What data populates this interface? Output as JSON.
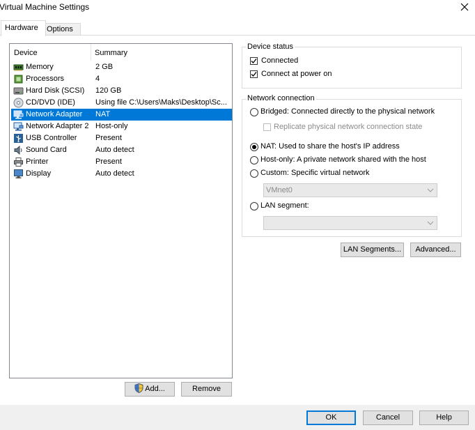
{
  "window": {
    "title": "Virtual Machine Settings"
  },
  "tabs": [
    {
      "label": "Hardware",
      "active": true
    },
    {
      "label": "Options",
      "active": false
    }
  ],
  "device_list": {
    "columns": [
      "Device",
      "Summary"
    ],
    "rows": [
      {
        "device": "Memory",
        "summary": "2 GB",
        "icon": "memory-icon",
        "selected": false
      },
      {
        "device": "Processors",
        "summary": "4",
        "icon": "processor-icon",
        "selected": false
      },
      {
        "device": "Hard Disk (SCSI)",
        "summary": "120 GB",
        "icon": "hard-disk-icon",
        "selected": false
      },
      {
        "device": "CD/DVD (IDE)",
        "summary": "Using file C:\\Users\\Maks\\Desktop\\Sc...",
        "icon": "cd-dvd-icon",
        "selected": false
      },
      {
        "device": "Network Adapter",
        "summary": "NAT",
        "icon": "network-adapter-icon",
        "selected": true
      },
      {
        "device": "Network Adapter 2",
        "summary": "Host-only",
        "icon": "network-adapter-icon",
        "selected": false
      },
      {
        "device": "USB Controller",
        "summary": "Present",
        "icon": "usb-icon",
        "selected": false
      },
      {
        "device": "Sound Card",
        "summary": "Auto detect",
        "icon": "sound-card-icon",
        "selected": false
      },
      {
        "device": "Printer",
        "summary": "Present",
        "icon": "printer-icon",
        "selected": false
      },
      {
        "device": "Display",
        "summary": "Auto detect",
        "icon": "display-icon",
        "selected": false
      }
    ],
    "add_label": "Add...",
    "remove_label": "Remove"
  },
  "device_status": {
    "legend": "Device status",
    "connected": {
      "label": "Connected",
      "checked": true
    },
    "connect_at_power_on": {
      "label": "Connect at power on",
      "checked": true
    }
  },
  "network_connection": {
    "legend": "Network connection",
    "bridged": {
      "label": "Bridged: Connected directly to the physical network",
      "selected": false
    },
    "replicate": {
      "label": "Replicate physical network connection state",
      "checked": false,
      "disabled": true
    },
    "nat": {
      "label": "NAT: Used to share the host's IP address",
      "selected": true
    },
    "host_only": {
      "label": "Host-only: A private network shared with the host",
      "selected": false
    },
    "custom": {
      "label": "Custom: Specific virtual network",
      "selected": false
    },
    "custom_network_value": "VMnet0",
    "lan_segment": {
      "label": "LAN segment:",
      "selected": false
    },
    "lan_segment_value": ""
  },
  "buttons": {
    "lan_segments": "LAN Segments...",
    "advanced": "Advanced...",
    "ok": "OK",
    "cancel": "Cancel",
    "help": "Help"
  },
  "colors": {
    "selection": "#0078d7",
    "button_face": "#e1e1e1",
    "footer": "#f0f0f0"
  }
}
